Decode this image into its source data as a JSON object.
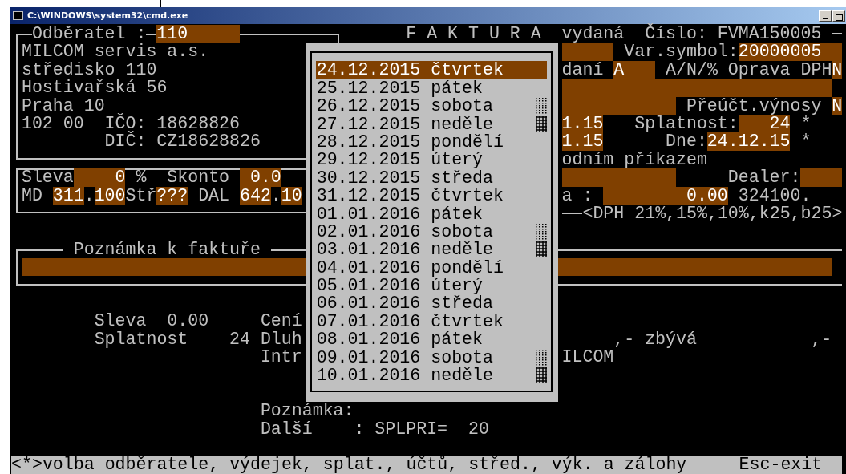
{
  "window": {
    "title": "C:\\WINDOWS\\system32\\cmd.exe"
  },
  "customer": {
    "label": "Odběratel :",
    "code": "110",
    "name": "MILCOM servis a.s.",
    "branch": "středisko 110",
    "street": "Hostivařská 56",
    "city": "Praha 10",
    "zip": "102 00",
    "ico_label": "IČO:",
    "ico": "18628826",
    "dic_label": "DIČ:",
    "dic": "CZ18628826"
  },
  "invoice": {
    "title": "F A K T U R A",
    "kind": "vydaná",
    "number_label": "Číslo:",
    "number": "FVMA150005",
    "var_symbol_label": "Var.symbol:",
    "var_symbol": "20000005",
    "tax_label": "daní",
    "tax_value": "A",
    "correction_label": "A/N/% Oprava DPH",
    "correction_value": "N",
    "reverse_label": "Přeúčt.výnosy",
    "reverse_value": "N",
    "date_1": "1.15",
    "due_label": "Splatnost:",
    "due_days": "24",
    "due_mark": "*",
    "date_2": "1.15",
    "date_label": "Dne:",
    "date": "24.12.15",
    "date_mark": "*",
    "payment_text": "odním příkazem",
    "dealer_label": "Dealer:",
    "amount_label": "a :",
    "amount": "0.00",
    "account": "324100.",
    "vat_rates": "<DPH 21%,15%,10%,k25,b25>"
  },
  "discounts": {
    "discount_label": "Sleva",
    "discount": "0",
    "percent": "%",
    "skonto_label": "Skonto",
    "skonto": "0.0",
    "md_label": "MD",
    "md_account": "311",
    "md_dot": ".",
    "md_sub": "100",
    "center_label": "Stř",
    "center": "???",
    "dal_label": "DAL",
    "dal_account": "642",
    "dal_dot": ".",
    "dal_sub": "10"
  },
  "note": {
    "title": "Poznámka k faktuře"
  },
  "summary": {
    "discount_label": "Sleva",
    "discount": "0.00",
    "due_label": "Splatnost",
    "due": "24",
    "price_label": "Cení",
    "debt_label": "Dluh",
    "intr_label": "Intr",
    "remaining_sep": ",-",
    "remaining_label": "zbývá",
    "remaining_sep_2": ",-",
    "company_tail": "ILCOM",
    "note_label": "Poznámka:",
    "more_label": "Další",
    "more_sep": ": SPLPRI=",
    "more_value": "20"
  },
  "calendar": [
    {
      "label": "24.12.2015 čtvrtek",
      "kind": "weekday",
      "selected": true
    },
    {
      "label": "25.12.2015 pátek",
      "kind": "weekday",
      "selected": false
    },
    {
      "label": "26.12.2015 sobota",
      "kind": "saturday",
      "selected": false
    },
    {
      "label": "27.12.2015 neděle",
      "kind": "sunday",
      "selected": false
    },
    {
      "label": "28.12.2015 pondělí",
      "kind": "weekday",
      "selected": false
    },
    {
      "label": "29.12.2015 úterý",
      "kind": "weekday",
      "selected": false
    },
    {
      "label": "30.12.2015 středa",
      "kind": "weekday",
      "selected": false
    },
    {
      "label": "31.12.2015 čtvrtek",
      "kind": "weekday",
      "selected": false
    },
    {
      "label": "01.01.2016 pátek",
      "kind": "weekday",
      "selected": false
    },
    {
      "label": "02.01.2016 sobota",
      "kind": "saturday",
      "selected": false
    },
    {
      "label": "03.01.2016 neděle",
      "kind": "sunday",
      "selected": false
    },
    {
      "label": "04.01.2016 pondělí",
      "kind": "weekday",
      "selected": false
    },
    {
      "label": "05.01.2016 úterý",
      "kind": "weekday",
      "selected": false
    },
    {
      "label": "06.01.2016 středa",
      "kind": "weekday",
      "selected": false
    },
    {
      "label": "07.01.2016 čtvrtek",
      "kind": "weekday",
      "selected": false
    },
    {
      "label": "08.01.2016 pátek",
      "kind": "weekday",
      "selected": false
    },
    {
      "label": "09.01.2016 sobota",
      "kind": "saturday",
      "selected": false
    },
    {
      "label": "10.01.2016 neděle",
      "kind": "sunday",
      "selected": false
    }
  ],
  "status_bar": {
    "hint": "<*>volba odběratele, výdejek, splat., účtů, střed., výk. a zálohy",
    "exit": "Esc-exit"
  }
}
